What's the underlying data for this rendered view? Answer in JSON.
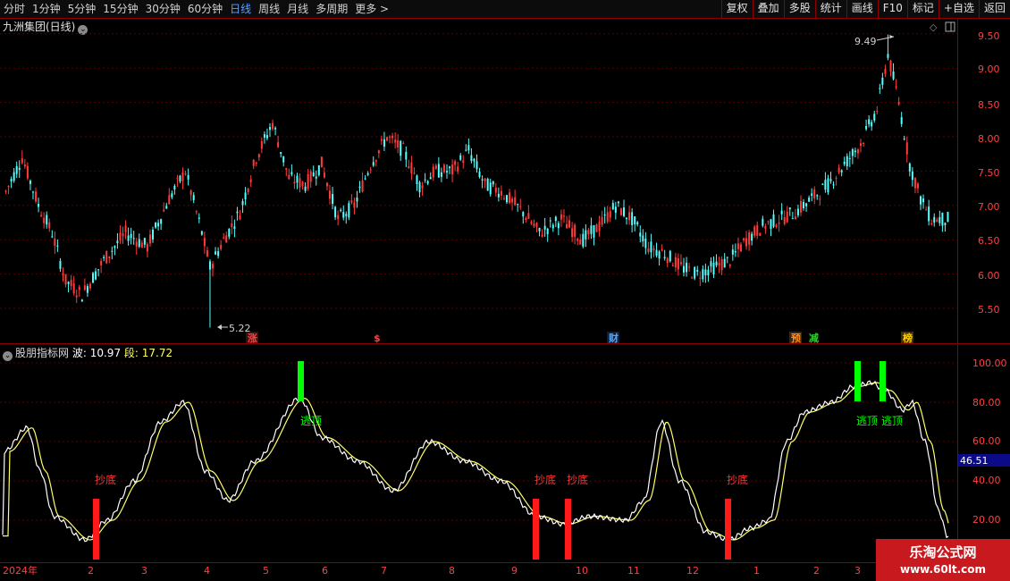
{
  "toolbar": {
    "periods": [
      "分时",
      "1分钟",
      "5分钟",
      "15分钟",
      "30分钟",
      "60分钟",
      "日线",
      "周线",
      "月线",
      "多周期",
      "更多 >"
    ],
    "active_period": "日线",
    "buttons": [
      "复权",
      "叠加",
      "多股",
      "统计",
      "画线",
      "F10",
      "标记",
      "+自选",
      "返回"
    ]
  },
  "main_pane": {
    "title": "九洲集团(日线)",
    "price_axis": [
      "9.50",
      "9.00",
      "8.50",
      "8.00",
      "7.50",
      "7.00",
      "6.50",
      "6.00",
      "5.50"
    ],
    "high_label": "9.49",
    "low_label": "5.22",
    "event_markers": [
      {
        "text": "涨",
        "color": "#ff4040"
      },
      {
        "text": "$",
        "color": "#ff4040"
      },
      {
        "text": "财",
        "color": "#4da6ff"
      },
      {
        "text": "预",
        "color": "#ff8c1a"
      },
      {
        "text": "减",
        "color": "#33cc33"
      },
      {
        "text": "榜",
        "color": "#ffcc00"
      }
    ],
    "colors": {
      "up": "#ff3b3b",
      "down": "#54ffff"
    }
  },
  "indicator_pane": {
    "name": "股朋指标网",
    "wave_label": "波:",
    "wave_value": "10.97",
    "seg_label": "段:",
    "seg_value": "17.72",
    "axis": [
      "100.00",
      "80.00",
      "60.00",
      "40.00",
      "20.00"
    ],
    "current_value": "46.51",
    "signals": [
      {
        "text": "抄底",
        "type": "buy"
      },
      {
        "text": "逃顶",
        "type": "sell"
      },
      {
        "text": "抄底",
        "type": "buy"
      },
      {
        "text": "抄底",
        "type": "buy"
      },
      {
        "text": "抄底",
        "type": "buy"
      },
      {
        "text": "逃顶",
        "type": "sell"
      },
      {
        "text": "逃顶",
        "type": "sell"
      }
    ],
    "colors": {
      "wave": "#ffffff",
      "seg": "#ffff66",
      "buy": "#ff1a1a",
      "sell": "#00ff00"
    }
  },
  "time_axis": [
    "2024年",
    "2",
    "3",
    "4",
    "5",
    "6",
    "7",
    "8",
    "9",
    "10",
    "11",
    "12",
    "1",
    "2",
    "3"
  ],
  "watermark": {
    "title": "乐淘公式网",
    "url": "www.60lt.com"
  }
}
